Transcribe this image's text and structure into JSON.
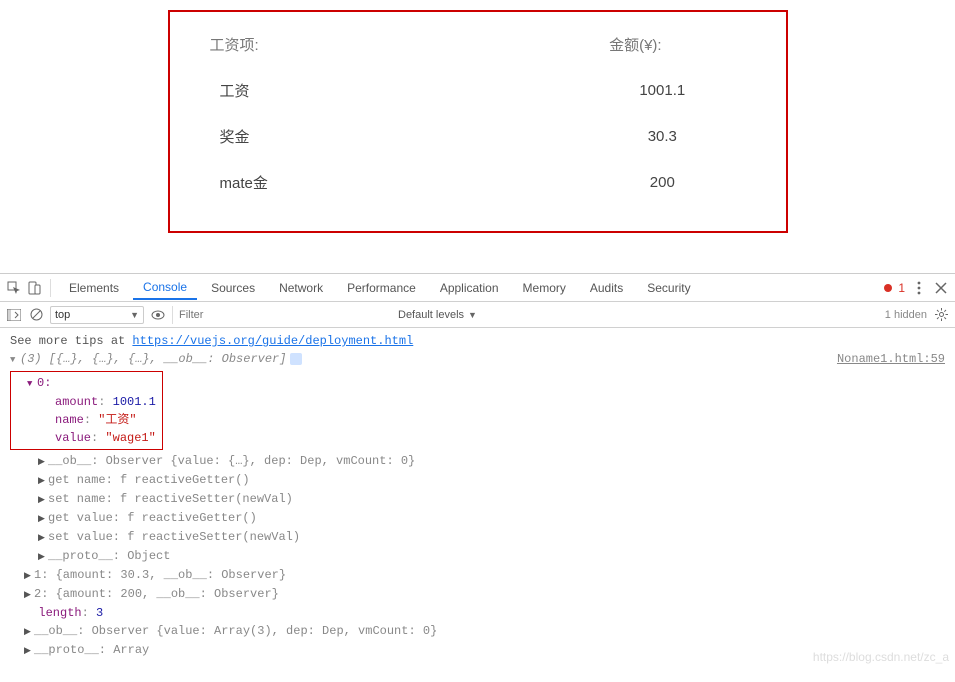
{
  "table": {
    "header_name": "工资项:",
    "header_amount": "金额(¥):",
    "rows": [
      {
        "name": "工资",
        "amount": "1001.1"
      },
      {
        "name": "奖金",
        "amount": "30.3"
      },
      {
        "name": "mate金",
        "amount": "200"
      }
    ]
  },
  "chart_data": {
    "type": "table",
    "columns": [
      "工资项",
      "金额(¥)"
    ],
    "rows": [
      [
        "工资",
        1001.1
      ],
      [
        "奖金",
        30.3
      ],
      [
        "mate金",
        200
      ]
    ]
  },
  "devtools": {
    "tabs": [
      "Elements",
      "Console",
      "Sources",
      "Network",
      "Performance",
      "Application",
      "Memory",
      "Audits",
      "Security"
    ],
    "active_tab": "Console",
    "error_count": "1",
    "context": "top",
    "filter_placeholder": "Filter",
    "levels": "Default levels",
    "hidden": "1 hidden",
    "tip_prefix": "See more tips at ",
    "tip_url": "https://vuejs.org/guide/deployment.html",
    "source_link": "Noname1.html:59",
    "log_head": "(3) [{…}, {…}, {…}, __ob__: Observer]",
    "obj0": {
      "index": "0:",
      "amount_k": "amount",
      "amount_v": "1001.1",
      "name_k": "name",
      "name_v": "\"工资\"",
      "value_k": "value",
      "value_v": "\"wage1\""
    },
    "lines_after": [
      "__ob__: Observer {value: {…}, dep: Dep, vmCount: 0}",
      "get name: f reactiveGetter()",
      "set name: f reactiveSetter(newVal)",
      "get value: f reactiveGetter()",
      "set value: f reactiveSetter(newVal)",
      "__proto__: Object"
    ],
    "idx1": "1: {amount: 30.3, __ob__: Observer}",
    "idx2": "2: {amount: 200, __ob__: Observer}",
    "length_line": "length: 3",
    "ob_line": "__ob__: Observer {value: Array(3), dep: Dep, vmCount: 0}",
    "proto_line": "__proto__: Array",
    "watermark": "https://blog.csdn.net/zc_a"
  }
}
